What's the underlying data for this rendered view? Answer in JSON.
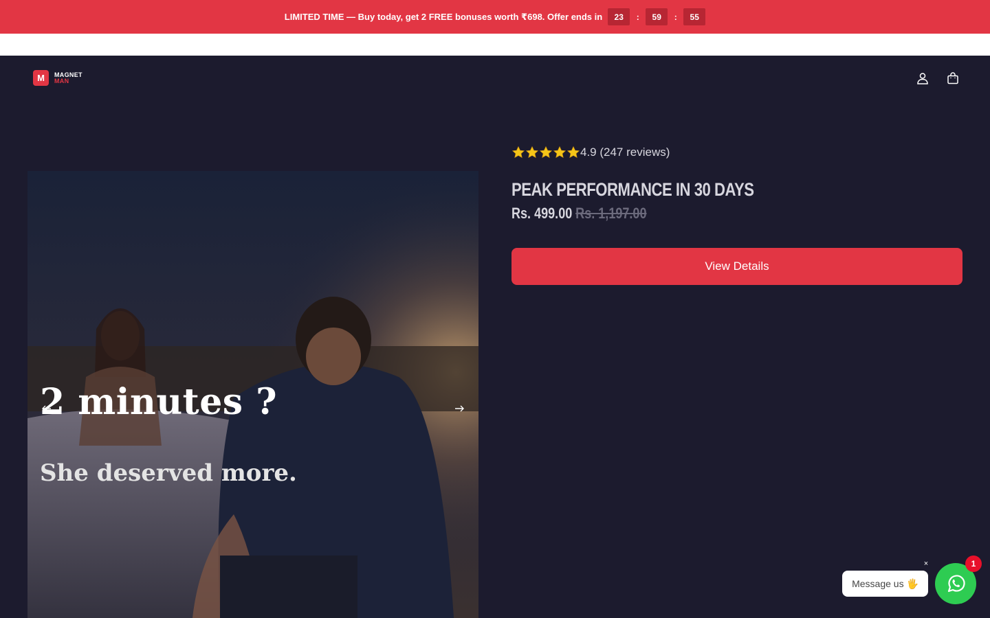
{
  "announcement": {
    "text": "LIMITED TIME — Buy today, get 2 FREE bonuses worth ₹698. Offer ends in",
    "timer": {
      "hours": "23",
      "minutes": "59",
      "seconds": "55",
      "separator": ":"
    }
  },
  "header": {
    "logo": {
      "mark": "M",
      "line1": "MAGNET",
      "line2": "MAN"
    },
    "icons": [
      "account-icon",
      "cart-icon"
    ]
  },
  "gallery": {
    "slide": {
      "headline": "2 minutes ?",
      "subline": "She deserved more."
    },
    "prev_icon": "arrow-left-icon",
    "next_icon": "arrow-right-icon"
  },
  "product": {
    "rating": {
      "stars": 5,
      "text": "4.9 (247 reviews)"
    },
    "title": "Peak Performance in 30 Days",
    "price": "Rs. 499.00",
    "compare_price": "Rs. 1,197.00",
    "cta_label": "View Details"
  },
  "chat": {
    "bubble_text": "Message us 🖐",
    "close_label": "×",
    "badge_count": "1",
    "icon": "whatsapp-icon"
  },
  "colors": {
    "accent": "#e23644",
    "background": "#1c1b2e",
    "whatsapp": "#2ecc52",
    "star": "#f5c518"
  }
}
